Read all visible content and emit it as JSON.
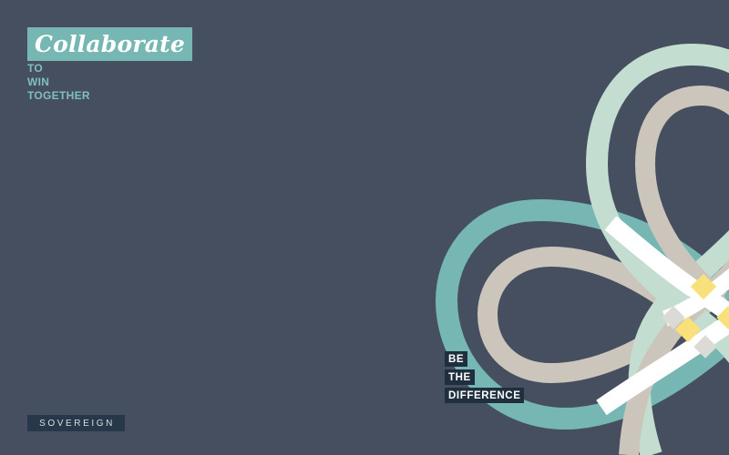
{
  "headline": "Collaborate",
  "subtitle": [
    "TO",
    "WIN",
    "TOGETHER"
  ],
  "tagline": [
    "BE",
    "THE",
    "DIFFERENCE"
  ],
  "logo_text": "SOVEREIGN",
  "colors": {
    "background": "#454f5f",
    "teal": "#76b7b4",
    "mint": "#c3ded0",
    "taupe": "#cbc5bb",
    "white": "#ffffff",
    "yellow": "#f8e07a",
    "navy": "#1f2f3f"
  }
}
